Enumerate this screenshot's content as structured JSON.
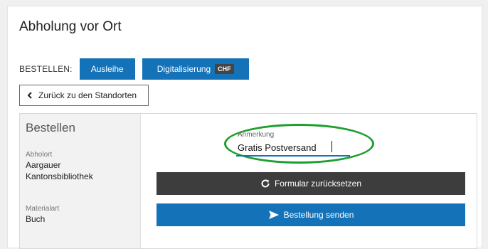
{
  "page": {
    "title": "Abholung vor Ort"
  },
  "order": {
    "label": "BESTELLEN:",
    "ausleihe_label": "Ausleihe",
    "digitalisierung_label": "Digitalisierung",
    "chf_badge": "CHF"
  },
  "back": {
    "label": "Zurück zu den Standorten",
    "icon": "chevron-left-icon"
  },
  "panel": {
    "heading": "Bestellen",
    "abholort_label": "Abholort",
    "abholort_line1": "Aargauer",
    "abholort_line2": "Kantonsbibliothek",
    "materialart_label": "Materialart",
    "materialart_value": "Buch"
  },
  "form": {
    "anmerkung_label": "Anmerkung",
    "anmerkung_value": "Gratis Postversand",
    "reset_label": "Formular zurücksetzen",
    "reset_icon": "refresh-icon",
    "send_label": "Bestellung senden",
    "send_icon": "paper-plane-icon"
  },
  "colors": {
    "primary": "#1473b8",
    "dark": "#3d3d3d",
    "highlight": "#1e9e2e"
  }
}
